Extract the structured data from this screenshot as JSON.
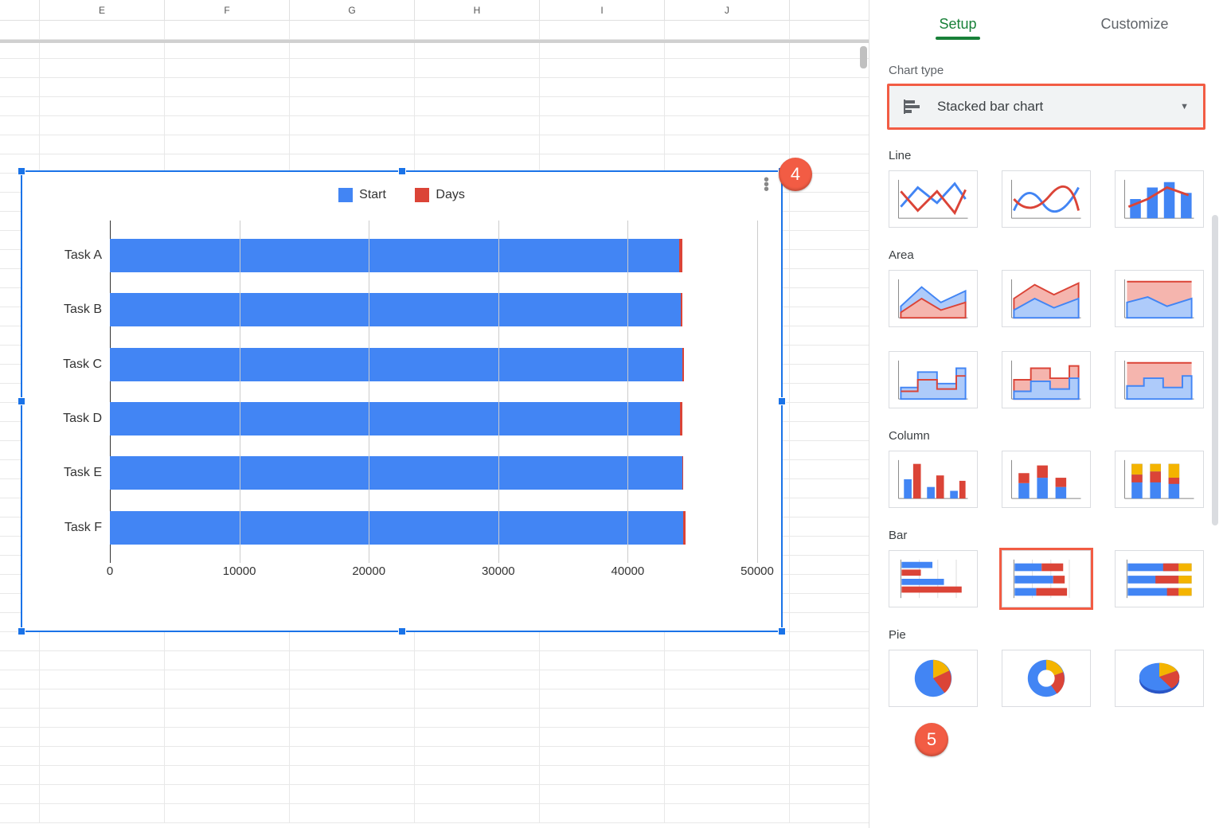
{
  "columns": [
    "",
    "E",
    "F",
    "G",
    "H",
    "I",
    "J"
  ],
  "chart": {
    "menu_icon": "more-vert",
    "legend": [
      {
        "label": "Start",
        "color": "#4285f4"
      },
      {
        "label": "Days",
        "color": "#db4437"
      }
    ]
  },
  "chart_data": {
    "type": "bar",
    "stacking": "stacked",
    "categories": [
      "Task A",
      "Task B",
      "Task C",
      "Task D",
      "Task E",
      "Task F"
    ],
    "series": [
      {
        "name": "Start",
        "values": [
          44000,
          44100,
          44200,
          44050,
          44200,
          44300
        ],
        "color": "#4285f4"
      },
      {
        "name": "Days",
        "values": [
          200,
          100,
          120,
          180,
          80,
          150
        ],
        "color": "#db4437"
      }
    ],
    "xlabel": "",
    "ylabel": "",
    "xlim": [
      0,
      50000
    ],
    "xticks": [
      0,
      10000,
      20000,
      30000,
      40000,
      50000
    ]
  },
  "sidebar": {
    "tabs": {
      "setup": "Setup",
      "customize": "Customize"
    },
    "chart_type_label": "Chart type",
    "chart_type_value": "Stacked bar chart",
    "groups": {
      "line": "Line",
      "area": "Area",
      "column": "Column",
      "bar": "Bar",
      "pie": "Pie"
    }
  },
  "annotations": {
    "a4": "4",
    "a5": "5"
  }
}
